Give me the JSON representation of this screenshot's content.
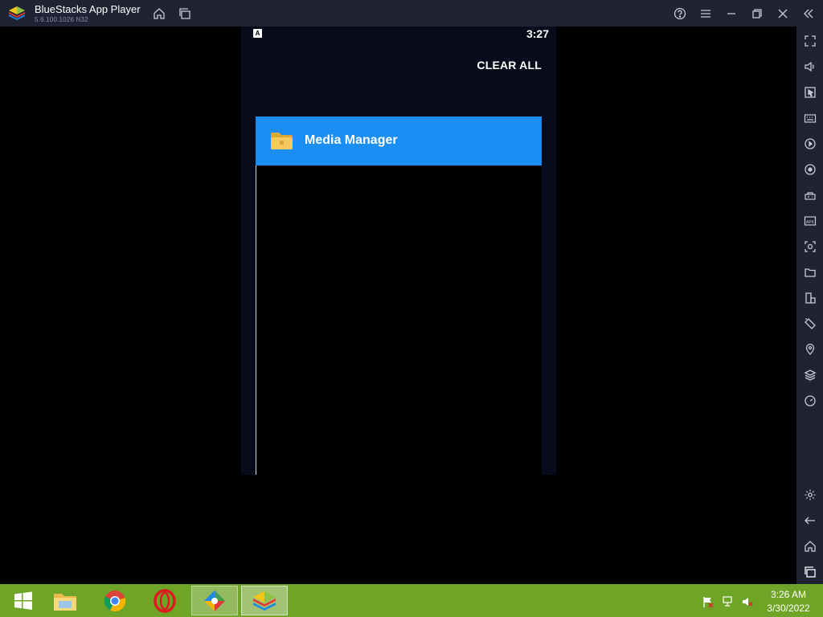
{
  "window": {
    "title": "BlueStacks App Player",
    "version": "5.6.100.1026 N32"
  },
  "titlebar_icons": [
    "home-icon",
    "multi-instance-icon",
    "help-icon",
    "menu-icon",
    "minimize-icon",
    "restore-icon",
    "close-icon",
    "collapse-sidebar-icon"
  ],
  "android": {
    "status_badge": "A",
    "clock": "3:27",
    "clear_all_label": "CLEAR ALL",
    "recent_app": {
      "label": "Media Manager",
      "icon": "folder-icon",
      "color": "#1a8ef2"
    }
  },
  "sidebar_icons": [
    "fullscreen-icon",
    "volume-icon",
    "cursor-icon",
    "keyboard-icon",
    "record-icon",
    "macro-icon",
    "gamepad-icon",
    "apk-icon",
    "screenshot-icon",
    "folder-icon",
    "multi-instance-icon",
    "rotate-icon",
    "location-icon",
    "layers-icon",
    "performance-icon",
    "settings-icon",
    "back-icon",
    "home-icon",
    "recents-icon"
  ],
  "taskbar": {
    "apps": [
      "windows-start-icon",
      "file-explorer-icon",
      "chrome-icon",
      "opera-icon",
      "multi-instance-manager-icon",
      "bluestacks-icon"
    ],
    "time": "3:26 AM",
    "date": "3/30/2022",
    "color": "#6fa527"
  }
}
